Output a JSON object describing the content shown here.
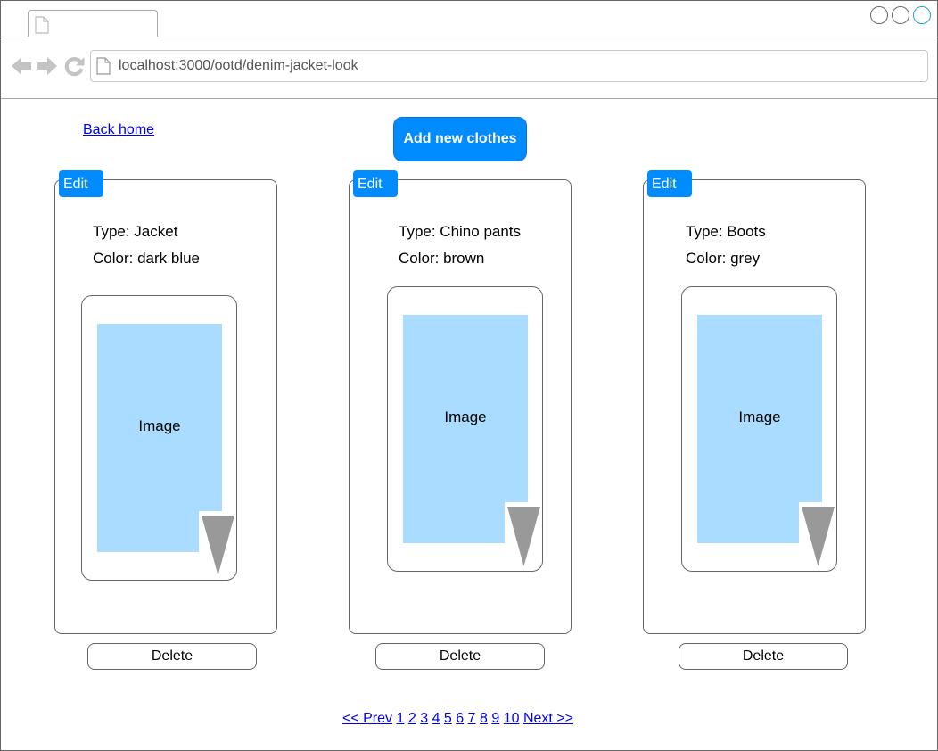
{
  "browser": {
    "url": "localhost:3000/ootd/denim-jacket-look",
    "icons": [
      "page-icon",
      "back-arrow-icon",
      "forward-arrow-icon",
      "reload-icon"
    ],
    "window_buttons": [
      "minimize-button",
      "maximize-button",
      "close-button"
    ]
  },
  "page": {
    "back_link": "Back home",
    "add_button": "Add new clothes",
    "cards": [
      {
        "edit": "Edit",
        "type": "Type: Jacket",
        "color": "Color: dark blue",
        "image": "Image",
        "delete": "Delete"
      },
      {
        "edit": "Edit",
        "type": "Type: Chino pants",
        "color": "Color: brown",
        "image": "Image",
        "delete": "Delete"
      },
      {
        "edit": "Edit",
        "type": "Type: Boots",
        "color": "Color: grey",
        "image": "Image",
        "delete": "Delete"
      }
    ],
    "pagination": {
      "prev": "<< Prev",
      "pages": [
        "1",
        "2",
        "3",
        "4",
        "5",
        "6",
        "7",
        "8",
        "9",
        "10"
      ],
      "next": "Next >>"
    }
  },
  "colors": {
    "accent": "#008cff",
    "link": "#0000ee",
    "image_fill": "#aadcff",
    "image_corner": "#999999",
    "border": "#666666"
  }
}
